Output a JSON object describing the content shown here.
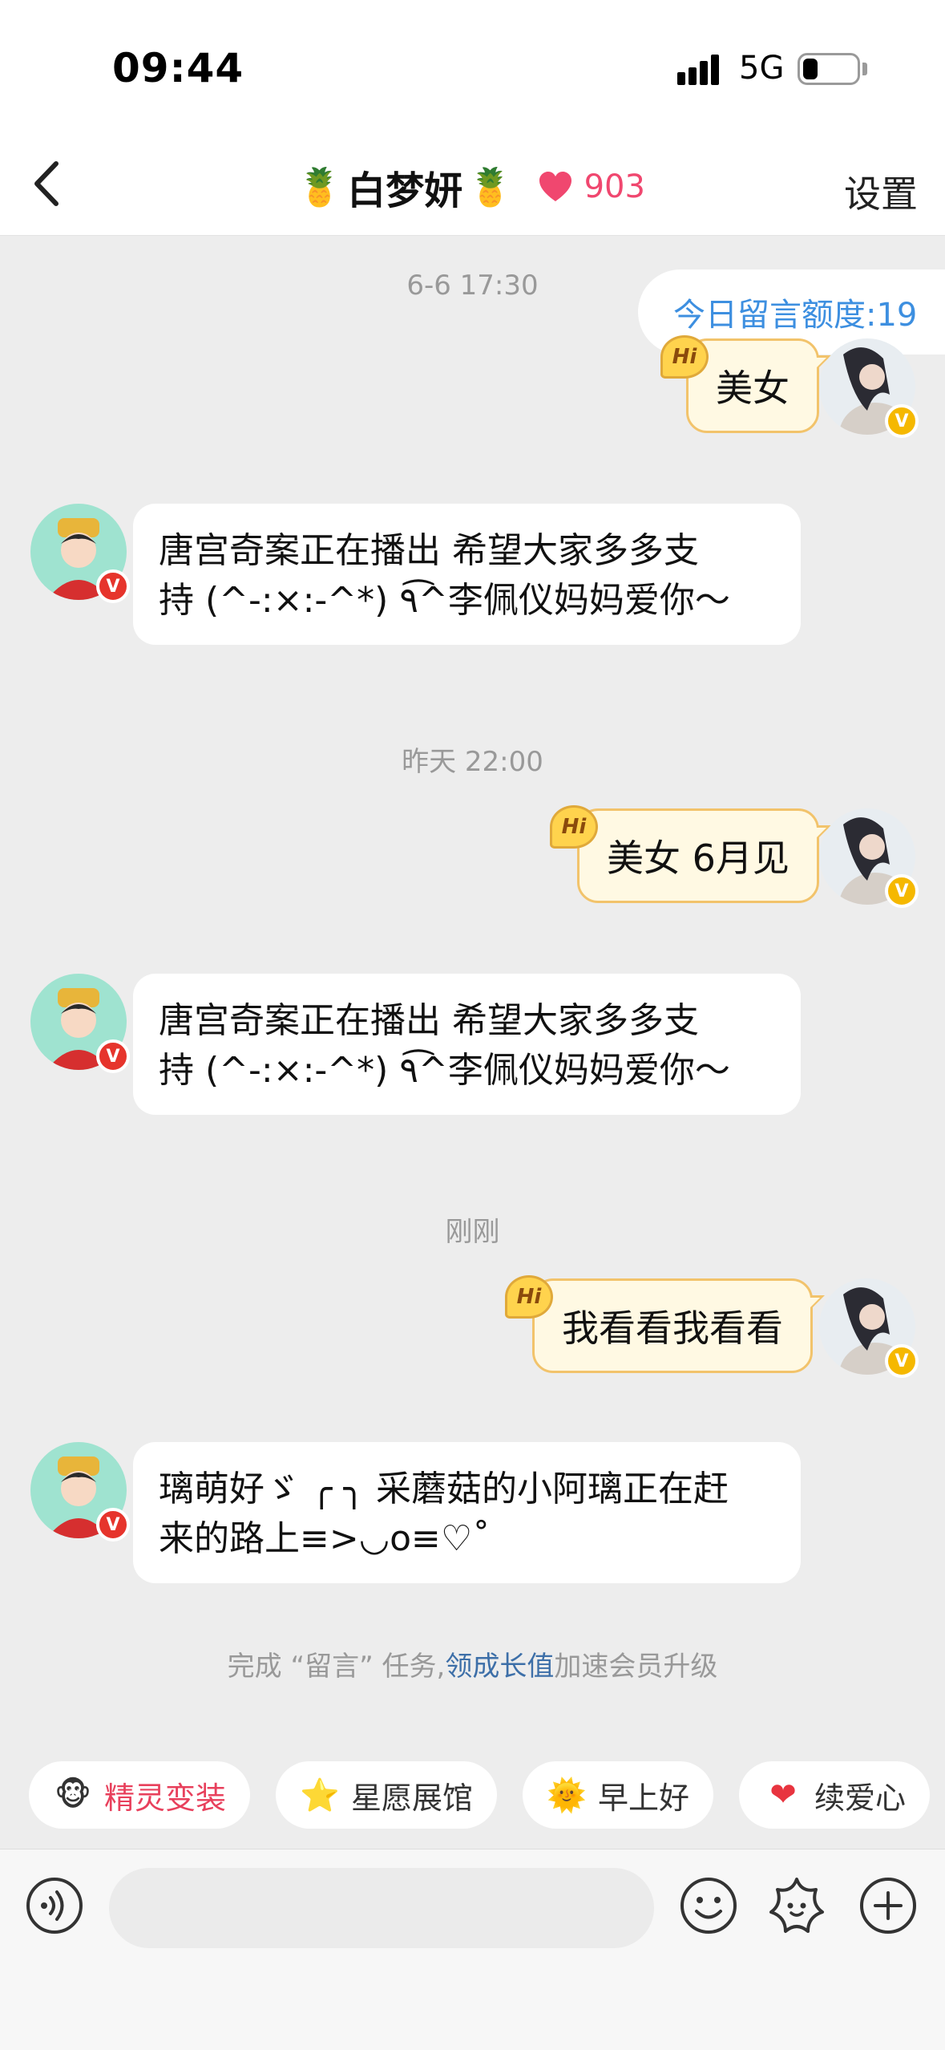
{
  "status_bar": {
    "time": "09:44",
    "network": "5G"
  },
  "header": {
    "title_prefix": "🍍",
    "title": "白梦妍",
    "title_suffix": "🍍",
    "heart_count": "903",
    "settings_label": "设置"
  },
  "quota": {
    "text": "今日留言额度:19"
  },
  "messages": [
    {
      "time": "6-6 17:30",
      "outgoing": "美女",
      "incoming_line1": "唐宫奇案正在播出 希望大家多多支",
      "incoming_line2": "持 (^-:×:-^*) ٩͡^李佩仪妈妈爱你～"
    },
    {
      "time": "昨天 22:00",
      "outgoing": "美女 6月见",
      "incoming_line1": "唐宫奇案正在播出 希望大家多多支",
      "incoming_line2": "持 (^-:×:-^*) ٩͡^李佩仪妈妈爱你～"
    },
    {
      "time": "刚刚",
      "outgoing": "我看看我看看",
      "incoming_line1": "璃萌好ゞ  ╭ ╮ 采蘑菇的小阿璃正在赶",
      "incoming_line2": "来的路上≡>◡o≡♡˚"
    }
  ],
  "hi_label": "Hi",
  "verified_badge": "V",
  "footer": {
    "prefix": "完成 “留言” 任务,",
    "link": "领成长值",
    "suffix": "加速会员升级"
  },
  "chips": [
    {
      "icon": "🐵",
      "label": "精灵变装",
      "color": "#e8405c"
    },
    {
      "icon": "⭐",
      "label": "星愿展馆",
      "color": "#333333"
    },
    {
      "icon": "🌞",
      "label": "早上好",
      "color": "#333333"
    },
    {
      "icon": "❤",
      "label": "续爱心",
      "color": "#333333"
    }
  ],
  "input": {
    "placeholder": ""
  },
  "icons": {
    "back": "back-chevron-icon",
    "voice": "voice-icon",
    "emoji": "emoji-icon",
    "sticker": "sticker-icon",
    "plus": "plus-icon"
  }
}
